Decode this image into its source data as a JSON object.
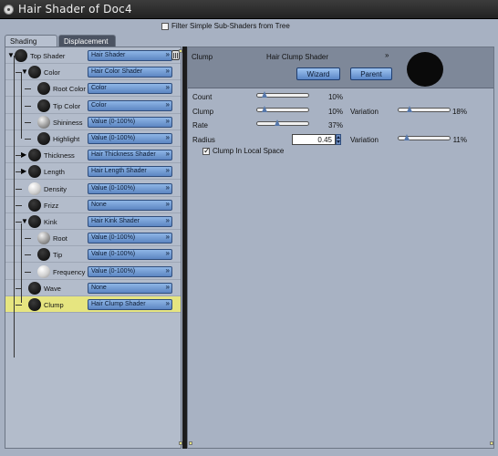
{
  "window": {
    "title": "Hair Shader of Doc4"
  },
  "filter": {
    "label": "Filter Simple Sub-Shaders from Tree",
    "checked": false
  },
  "tabs": [
    {
      "label": "Shading",
      "active": true
    },
    {
      "label": "Displacement",
      "active": false
    }
  ],
  "tree": [
    {
      "label": "Top Shader",
      "shader": "Hair Shader",
      "thumb": "dark",
      "level": 0,
      "expanded": true
    },
    {
      "label": "Color",
      "shader": "Hair Color Shader",
      "thumb": "dark",
      "level": 1,
      "expanded": true
    },
    {
      "label": "Root Color",
      "shader": "Color",
      "thumb": "dark",
      "level": 2
    },
    {
      "label": "Tip Color",
      "shader": "Color",
      "thumb": "dark",
      "level": 2
    },
    {
      "label": "Shininess",
      "shader": "Value (0-100%)",
      "thumb": "gray",
      "level": 2
    },
    {
      "label": "Highlight",
      "shader": "Value (0-100%)",
      "thumb": "dark",
      "level": 2
    },
    {
      "label": "Thickness",
      "shader": "Hair Thickness Shader",
      "thumb": "dark",
      "level": 1,
      "expandable": true
    },
    {
      "label": "Length",
      "shader": "Hair Length Shader",
      "thumb": "dark",
      "level": 1,
      "expandable": true
    },
    {
      "label": "Density",
      "shader": "Value (0-100%)",
      "thumb": "light",
      "level": 1
    },
    {
      "label": "Frizz",
      "shader": "None",
      "thumb": "dark",
      "level": 1
    },
    {
      "label": "Kink",
      "shader": "Hair Kink Shader",
      "thumb": "dark",
      "level": 1,
      "expanded": true
    },
    {
      "label": "Root",
      "shader": "Value (0-100%)",
      "thumb": "gray",
      "level": 2
    },
    {
      "label": "Tip",
      "shader": "Value (0-100%)",
      "thumb": "dark",
      "level": 2
    },
    {
      "label": "Frequency",
      "shader": "Value (0-100%)",
      "thumb": "light",
      "level": 2
    },
    {
      "label": "Wave",
      "shader": "None",
      "thumb": "dark",
      "level": 1
    },
    {
      "label": "Clump",
      "shader": "Hair Clump Shader",
      "thumb": "dark",
      "level": 1,
      "selected": true
    }
  ],
  "details": {
    "name": "Clump",
    "shader": "Hair Clump Shader",
    "menu_arrow": "»",
    "wizard_label": "Wizard",
    "parent_label": "Parent",
    "params": {
      "count": {
        "label": "Count",
        "value": "10%",
        "level": 0.1
      },
      "clump": {
        "label": "Clump",
        "value": "10%",
        "level": 0.1,
        "variation_label": "Variation",
        "variation_value": "18%",
        "variation_level": 0.18
      },
      "rate": {
        "label": "Rate",
        "value": "37%",
        "level": 0.37
      },
      "radius": {
        "label": "Radius",
        "value": "0.45",
        "variation_label": "Variation",
        "variation_value": "11%",
        "variation_level": 0.11
      }
    },
    "clump_local": {
      "label": "Clump In Local Space",
      "checked": true
    }
  }
}
